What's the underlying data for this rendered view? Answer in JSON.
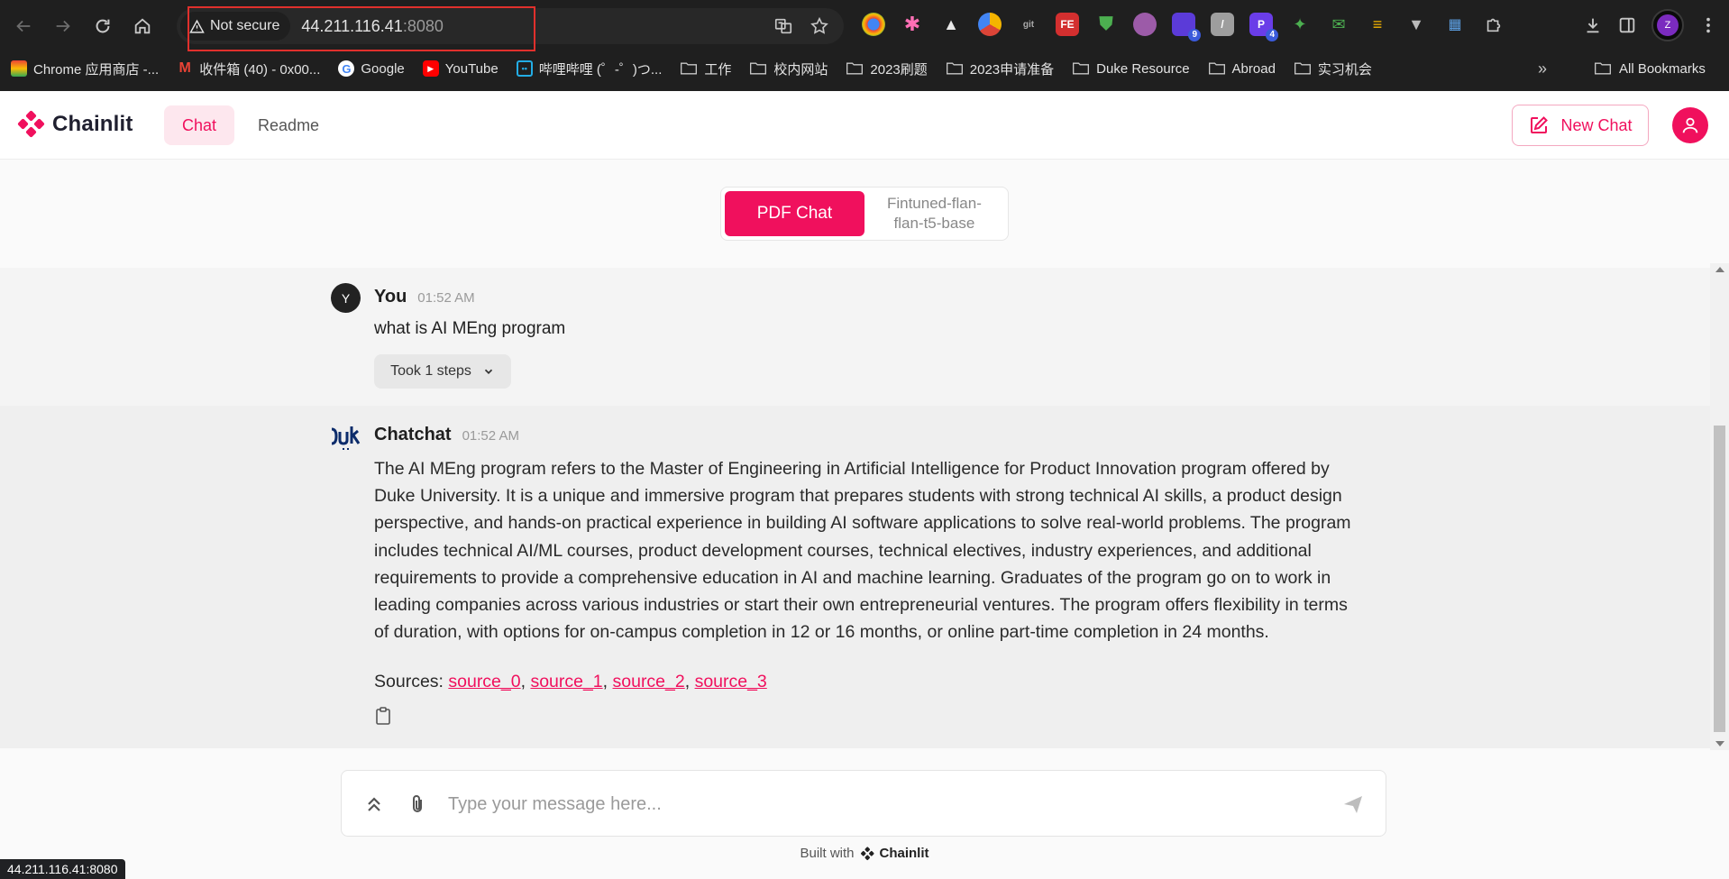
{
  "browser": {
    "not_secure_label": "Not secure",
    "url_host": "44.211.116.41",
    "url_port": ":8080",
    "profile_initial": "Z",
    "extension_badges": {
      "ext_9": "9",
      "ext_4": "4"
    },
    "bookmarks": [
      {
        "label": "Chrome 应用商店 -...",
        "icon": "chrome-store-icon"
      },
      {
        "label": "收件箱 (40) - 0x00...",
        "icon": "gmail-icon"
      },
      {
        "label": "Google",
        "icon": "google-icon"
      },
      {
        "label": "YouTube",
        "icon": "youtube-icon"
      },
      {
        "label": "哔哩哔哩 (゜-゜)つ...",
        "icon": "bilibili-icon"
      },
      {
        "label": "工作",
        "icon": "folder-icon"
      },
      {
        "label": "校内网站",
        "icon": "folder-icon"
      },
      {
        "label": "2023刷题",
        "icon": "folder-icon"
      },
      {
        "label": "2023申请准备",
        "icon": "folder-icon"
      },
      {
        "label": "Duke Resource",
        "icon": "folder-icon"
      },
      {
        "label": "Abroad",
        "icon": "folder-icon"
      },
      {
        "label": "实习机会",
        "icon": "folder-icon"
      }
    ],
    "overflow_label": "»",
    "all_bookmarks_label": "All Bookmarks",
    "status_bar_url": "44.211.116.41:8080"
  },
  "app": {
    "logo_text": "Chainlit",
    "tabs": [
      {
        "label": "Chat",
        "active": true
      },
      {
        "label": "Readme",
        "active": false
      }
    ],
    "new_chat_label": "New Chat",
    "accent_color": "#f0105d"
  },
  "chat_profiles": [
    {
      "label": "PDF Chat",
      "active": true
    },
    {
      "label": "Fintuned-flan-flan-t5-base",
      "active": false
    }
  ],
  "messages": {
    "user": {
      "avatar_initial": "Y",
      "author": "You",
      "time": "01:52 AM",
      "text": "what is AI MEng program",
      "steps_label": "Took 1 steps"
    },
    "assistant": {
      "author": "Chatchat",
      "time": "01:52 AM",
      "text": "The AI MEng program refers to the Master of Engineering in Artificial Intelligence for Product Innovation program offered by Duke University. It is a unique and immersive program that prepares students with strong technical AI skills, a product design perspective, and hands-on practical experience in building AI software applications to solve real-world problems. The program includes technical AI/ML courses, product development courses, technical electives, industry experiences, and additional requirements to provide a comprehensive education in AI and machine learning. Graduates of the program go on to work in leading companies across various industries or start their own entrepreneurial ventures. The program offers flexibility in terms of duration, with options for on-campus completion in 12 or 16 months, or online part-time completion in 24 months.",
      "sources_label": "Sources:",
      "sources": [
        "source_0",
        "source_1",
        "source_2",
        "source_3"
      ]
    }
  },
  "composer": {
    "placeholder": "Type your message here..."
  },
  "footer": {
    "built_with_label": "Built with",
    "brand": "Chainlit"
  }
}
